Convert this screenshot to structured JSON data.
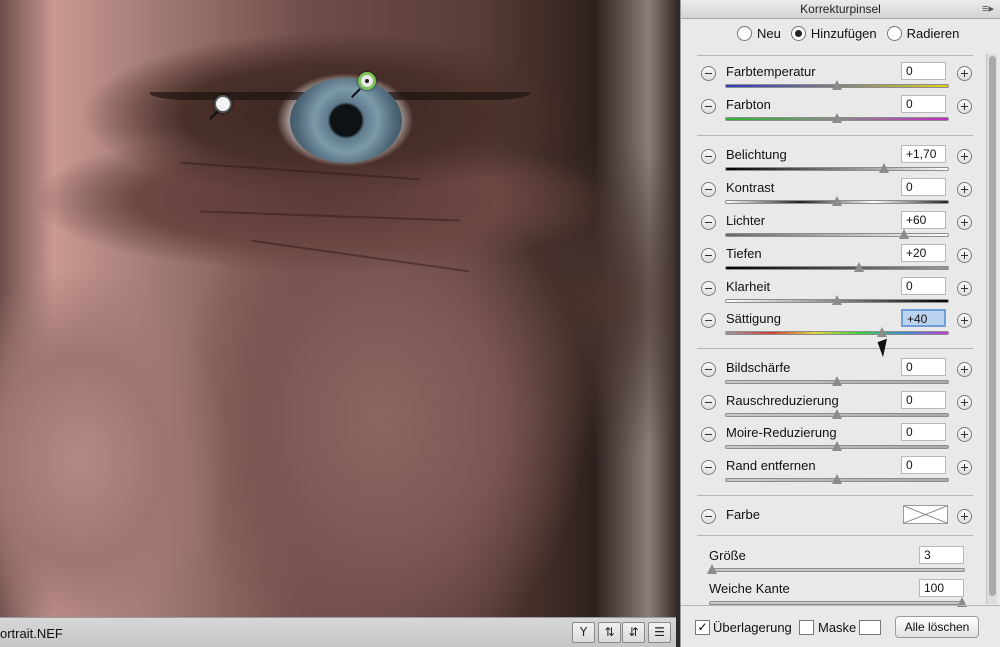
{
  "photo": {
    "filename": "ortrait.NEF"
  },
  "panel": {
    "title": "Korrekturpinsel",
    "modes": [
      {
        "label": "Neu",
        "selected": false
      },
      {
        "label": "Hinzufügen",
        "selected": true
      },
      {
        "label": "Radieren",
        "selected": false
      }
    ],
    "sliders": [
      {
        "label": "Farbtemperatur",
        "value": "0",
        "pos": 0.5,
        "track": "linear-gradient(90deg,#2e39c8,#7e7e7e,#e0d21a)"
      },
      {
        "label": "Farbton",
        "value": "0",
        "pos": 0.5,
        "track": "linear-gradient(90deg,#2db52d,#8a8a8a,#c42bc4)"
      },
      {
        "label": "Belichtung",
        "value": "+1,70",
        "pos": 0.71,
        "track": "linear-gradient(90deg,#000,#fff)"
      },
      {
        "label": "Kontrast",
        "value": "0",
        "pos": 0.5,
        "track": "linear-gradient(90deg,#fff,#222,#fff,#222)"
      },
      {
        "label": "Lichter",
        "value": "+60",
        "pos": 0.8,
        "track": "linear-gradient(90deg,#666,#fff)"
      },
      {
        "label": "Tiefen",
        "value": "+20",
        "pos": 0.6,
        "track": "linear-gradient(90deg,#000,#999)"
      },
      {
        "label": "Klarheit",
        "value": "0",
        "pos": 0.5,
        "track": "linear-gradient(90deg,#fff,#888,#000)"
      },
      {
        "label": "Sättigung",
        "value": "+40",
        "pos": 0.7,
        "selected": true,
        "track": "linear-gradient(90deg,#999,#d43b3b,#e3d63b,#3bd43b,#3b8bd4,#c43bd4)"
      },
      {
        "label": "Bildschärfe",
        "value": "0",
        "pos": 0.5,
        "track": "linear-gradient(90deg,#c8c8c8,#aaa)"
      },
      {
        "label": "Rauschreduzierung",
        "value": "0",
        "pos": 0.5,
        "track": "linear-gradient(90deg,#c8c8c8,#aaa)"
      },
      {
        "label": "Moire-Reduzierung",
        "value": "0",
        "pos": 0.5,
        "track": "linear-gradient(90deg,#c8c8c8,#aaa)"
      },
      {
        "label": "Rand entfernen",
        "value": "0",
        "pos": 0.5,
        "track": "linear-gradient(90deg,#c8c8c8,#aaa)"
      }
    ],
    "farbe_label": "Farbe",
    "brush": [
      {
        "label": "Größe",
        "value": "3",
        "pos": 0.01
      },
      {
        "label": "Weiche Kante",
        "value": "100",
        "pos": 0.99
      }
    ],
    "footer": {
      "overlay_label": "Überlagerung",
      "overlay_checked": true,
      "mask_label": "Maske",
      "mask_checked": false,
      "clear_label": "Alle löschen"
    }
  }
}
